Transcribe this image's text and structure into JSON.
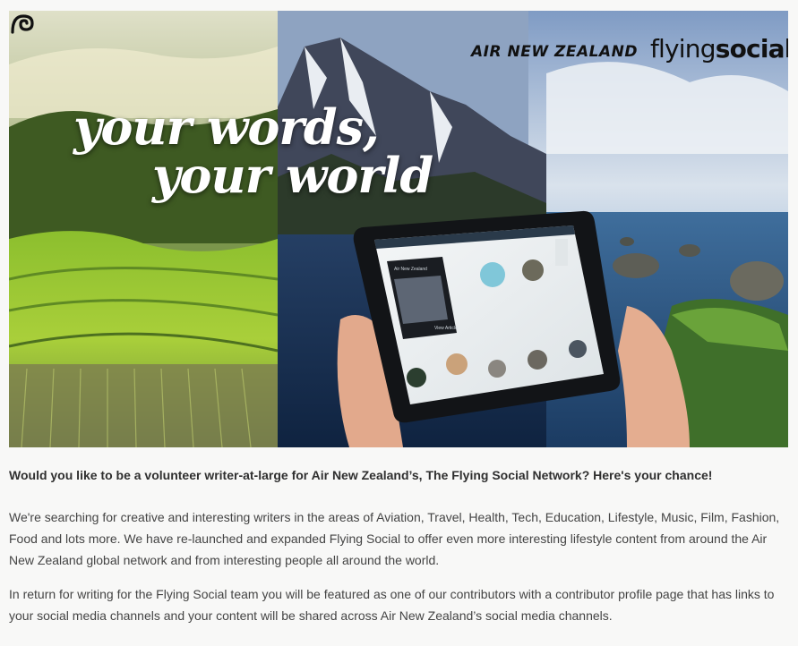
{
  "banner": {
    "headline_line1": "your words,",
    "headline_line2": "your world",
    "brand_airline": "AIR NEW ZEALAND",
    "brand_product_part1": "flying",
    "brand_product_part2": "social",
    "koru_icon": "koru-icon",
    "tablet_screen": {
      "brand": "Air New Zealand",
      "cta": "View Article"
    }
  },
  "article": {
    "lead": "Would you like to be a volunteer writer-at-large for Air New Zealand’s, The Flying Social Network? Here's your chance!",
    "paragraph1": "We're searching for creative and interesting writers in the areas of Aviation, Travel, Health, Tech, Education, Lifestyle, Music, Film, Fashion, Food and lots more.  We have re-launched and expanded Flying Social to offer even more interesting lifestyle content from around the Air New Zealand global network and from interesting people all around the world.",
    "paragraph2": "In return for writing for the Flying Social team you will be featured as one of our contributors with a contributor profile page that has links to your social media channels and your content will be shared across Air New Zealand’s social media channels."
  }
}
